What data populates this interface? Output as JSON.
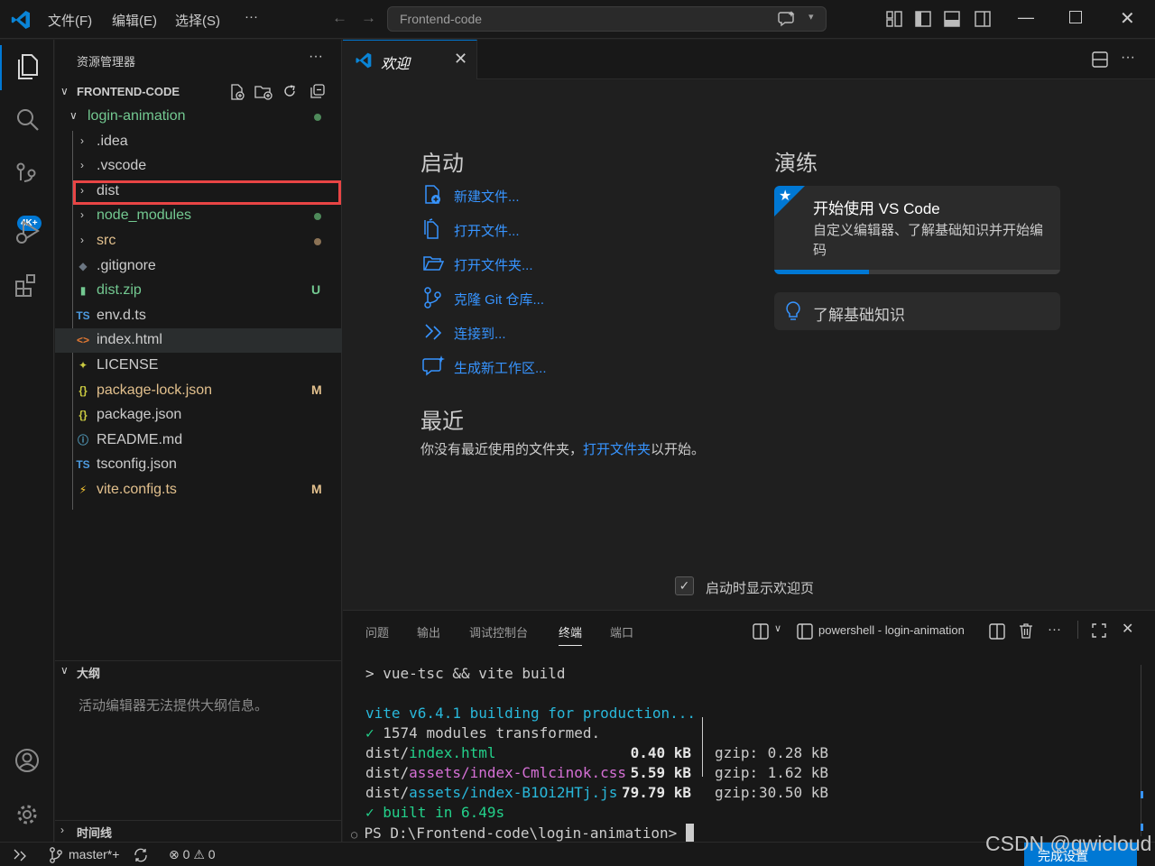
{
  "titlebar": {
    "menu": [
      "文件(F)",
      "编辑(E)",
      "选择(S)",
      "···"
    ],
    "search_text": "Frontend-code"
  },
  "activity": {
    "scm_badge": "4K+"
  },
  "sidebar": {
    "title": "资源管理器",
    "more": "···",
    "section_title": "FRONTEND-CODE",
    "tree": [
      {
        "name": "login-animation",
        "color": "#73c991",
        "indicator": "dot",
        "ind_color": "#4e8a5a"
      },
      {
        "name": ".idea",
        "color": "#cccccc"
      },
      {
        "name": ".vscode",
        "color": "#cccccc"
      },
      {
        "name": "dist",
        "color": "#cccccc"
      },
      {
        "name": "node_modules",
        "color": "#73c991",
        "indicator": "dot",
        "ind_color": "#4e8a5a"
      },
      {
        "name": "src",
        "color": "#e2c08d",
        "indicator": "dot",
        "ind_color": "#8b7255"
      },
      {
        "name": ".gitignore",
        "color": "#cccccc"
      },
      {
        "name": "dist.zip",
        "color": "#73c991",
        "deco": "U"
      },
      {
        "name": "env.d.ts",
        "color": "#cccccc"
      },
      {
        "name": "index.html",
        "color": "#cccccc"
      },
      {
        "name": "LICENSE",
        "color": "#cccccc"
      },
      {
        "name": "package-lock.json",
        "color": "#e2c08d",
        "deco": "M"
      },
      {
        "name": "package.json",
        "color": "#cccccc"
      },
      {
        "name": "README.md",
        "color": "#cccccc"
      },
      {
        "name": "tsconfig.json",
        "color": "#cccccc"
      },
      {
        "name": "vite.config.ts",
        "color": "#e2c08d",
        "deco": "M"
      }
    ],
    "outline_title": "大纲",
    "outline_msg": "活动编辑器无法提供大纲信息。",
    "timeline_title": "时间线"
  },
  "editor": {
    "tab_label": "欢迎",
    "start_heading": "启动",
    "start_items": [
      "新建文件...",
      "打开文件...",
      "打开文件夹...",
      "克隆 Git 仓库...",
      "连接到...",
      "生成新工作区..."
    ],
    "recent_heading": "最近",
    "recent_pre": "你没有最近使用的文件夹，",
    "recent_link": "打开文件夹",
    "recent_post": "以开始。",
    "walk_heading": "演练",
    "walk_title": "开始使用 VS Code",
    "walk_desc": "自定义编辑器、了解基础知识并开始编码",
    "walk_progress": 0.33,
    "basics_label": "了解基础知识",
    "show_welcome": "启动时显示欢迎页"
  },
  "panel": {
    "tabs": [
      "问题",
      "输出",
      "调试控制台",
      "终端",
      "端口"
    ],
    "active_tab": "终端",
    "terminal_name": "powershell - login-animation",
    "cmd": "> vue-tsc && vite build",
    "vite_line": "vite v6.4.1 building for production...",
    "modules_check": "✓",
    "modules_text": " 1574 modules transformed.",
    "assets": [
      {
        "dir": "dist/",
        "file": "index.html",
        "size": "0.40 kB",
        "gz_label": "gzip:",
        "gzip": "0.28 kB",
        "kind": "html"
      },
      {
        "dir": "dist/",
        "file": "assets/index-Cmlcinok.css",
        "size": "5.59 kB",
        "gz_label": "gzip:",
        "gzip": "1.62 kB",
        "kind": "css"
      },
      {
        "dir": "dist/",
        "file": "assets/index-B1Oi2HTj.js",
        "size": "79.79 kB",
        "gz_label": "gzip:",
        "gzip": "30.50 kB",
        "kind": "js"
      }
    ],
    "built": "✓ built in 6.49s",
    "prompt": "PS D:\\Frontend-code\\login-animation> "
  },
  "statusbar": {
    "branch": "master*+",
    "errors": "0",
    "warnings": "0"
  },
  "watermark": "CSDN @gwicloud",
  "watermark_overlay": "完成设置"
}
